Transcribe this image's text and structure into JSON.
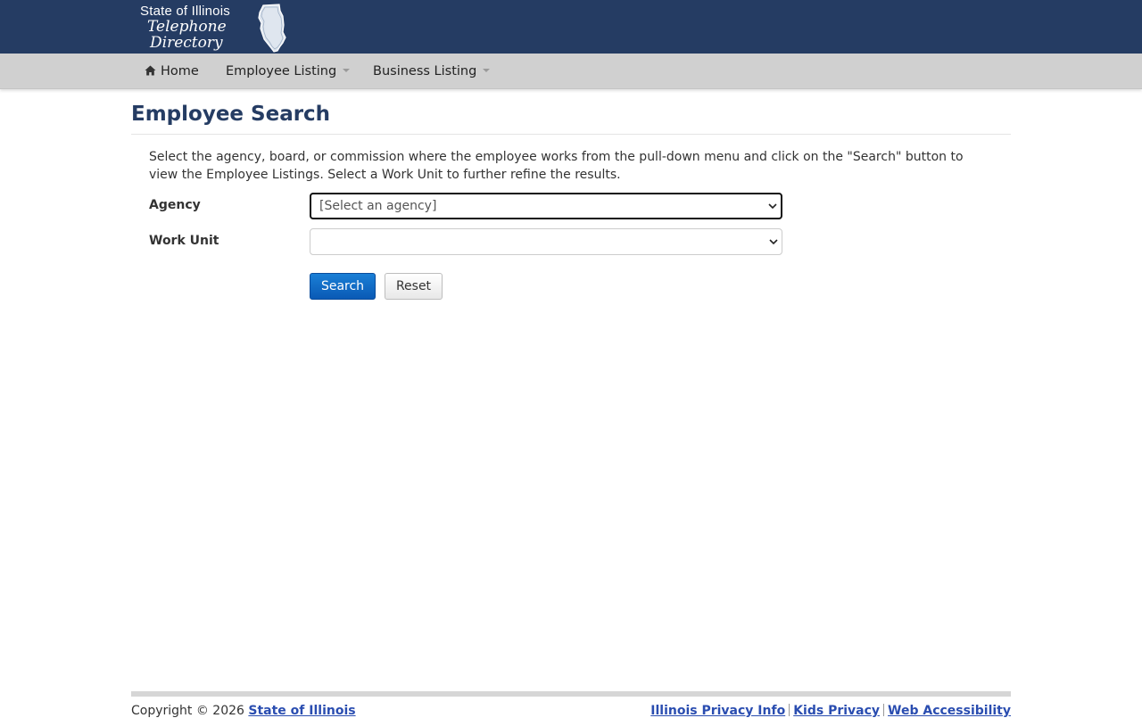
{
  "logo": {
    "line1": "State of Illinois",
    "line2": "Telephone",
    "line3": "Directory"
  },
  "nav": {
    "home": "Home",
    "employee_listing": "Employee Listing",
    "business_listing": "Business Listing"
  },
  "page": {
    "title": "Employee Search",
    "intro": "Select the agency, board, or commission where the employee works from the pull-down menu and click on the \"Search\" button to view the Employee Listings. Select a Work Unit to further refine the results."
  },
  "form": {
    "agency_label": "Agency",
    "agency_value": "[Select an agency]",
    "work_unit_label": "Work Unit",
    "work_unit_value": "",
    "search_button": "Search",
    "reset_button": "Reset"
  },
  "footer": {
    "copyright": "Copyright © 2026 ",
    "state_link": "State of Illinois",
    "links": [
      "Illinois Privacy Info",
      "Kids Privacy",
      "Web Accessibility"
    ]
  },
  "colors": {
    "header_bg": "#253c63",
    "navbar_bg": "#d0d0d0",
    "title": "#253c63",
    "primary_button": "#0a5ab5",
    "link": "#2a4db0"
  }
}
